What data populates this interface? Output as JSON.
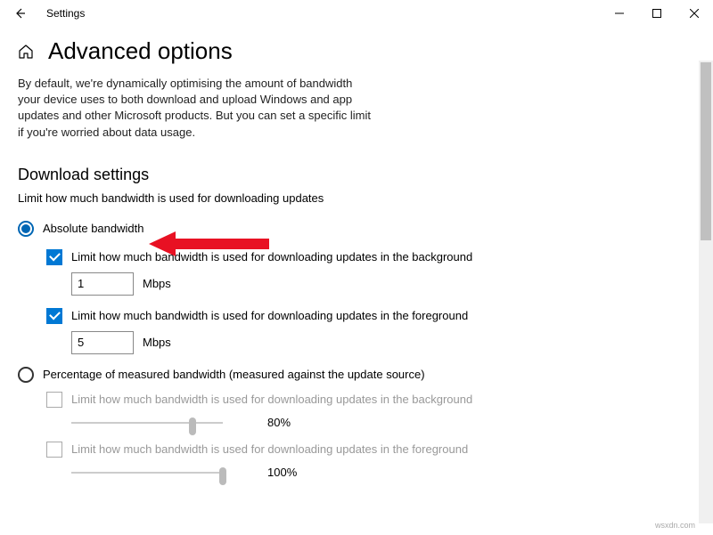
{
  "titlebar": {
    "title": "Settings"
  },
  "header": {
    "title": "Advanced options"
  },
  "description": "By default, we're dynamically optimising the amount of bandwidth your device uses to both download and upload Windows and app updates and other Microsoft products. But you can set a specific limit if you're worried about data usage.",
  "section": {
    "title": "Download settings",
    "subtitle": "Limit how much bandwidth is used for downloading updates"
  },
  "options": {
    "absolute": {
      "label": "Absolute bandwidth",
      "bg_check": "Limit how much bandwidth is used for downloading updates in the background",
      "bg_value": "1",
      "bg_unit": "Mbps",
      "fg_check": "Limit how much bandwidth is used for downloading updates in the foreground",
      "fg_value": "5",
      "fg_unit": "Mbps"
    },
    "percentage": {
      "label": "Percentage of measured bandwidth (measured against the update source)",
      "bg_check": "Limit how much bandwidth is used for downloading updates in the background",
      "bg_value": "80%",
      "fg_check": "Limit how much bandwidth is used for downloading updates in the foreground",
      "fg_value": "100%"
    }
  },
  "watermark": "wsxdn.com"
}
